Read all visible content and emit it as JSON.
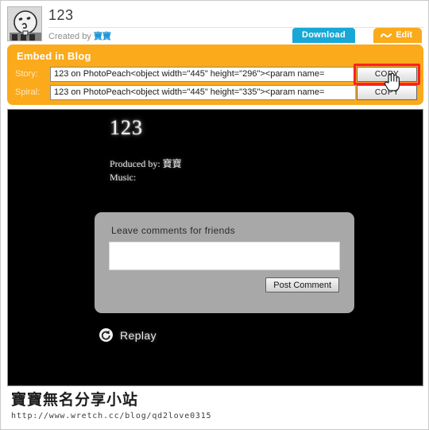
{
  "header": {
    "title": "123",
    "created_prefix": "Created by ",
    "author": "寶寶",
    "avatar_icon": "cartoon-face-avatar",
    "download_label": "Download",
    "edit_label": "Edit",
    "edit_icon": "wrench-icon",
    "accent_orange": "#fbaa1b",
    "accent_blue": "#19a8d6"
  },
  "embed": {
    "panel_title": "Embed in Blog",
    "rows": [
      {
        "label": "Story:",
        "value": "123 on PhotoPeach<object width=\"445\" height=\"296\"><param name=",
        "copy_label": "COPY",
        "highlighted": "true"
      },
      {
        "label": "Spiral:",
        "value": "123 on PhotoPeach<object width=\"445\" height=\"335\"><param name=",
        "copy_label": "COPY",
        "highlighted": "false"
      }
    ],
    "highlight_color": "#ff2020",
    "cursor_icon": "hand-pointer-cursor"
  },
  "player": {
    "title": "123",
    "produced_by": "Produced by: 寶寶",
    "music": "Music:",
    "comment_label": "Leave comments for friends",
    "comment_value": "",
    "post_button": "Post Comment",
    "replay_label": "Replay",
    "replay_icon": "replay-circle-arrow-icon",
    "background": "#000000"
  },
  "footer": {
    "site_name": "寶寶無名分享小站",
    "url": "http://www.wretch.cc/blog/qd2love0315"
  }
}
